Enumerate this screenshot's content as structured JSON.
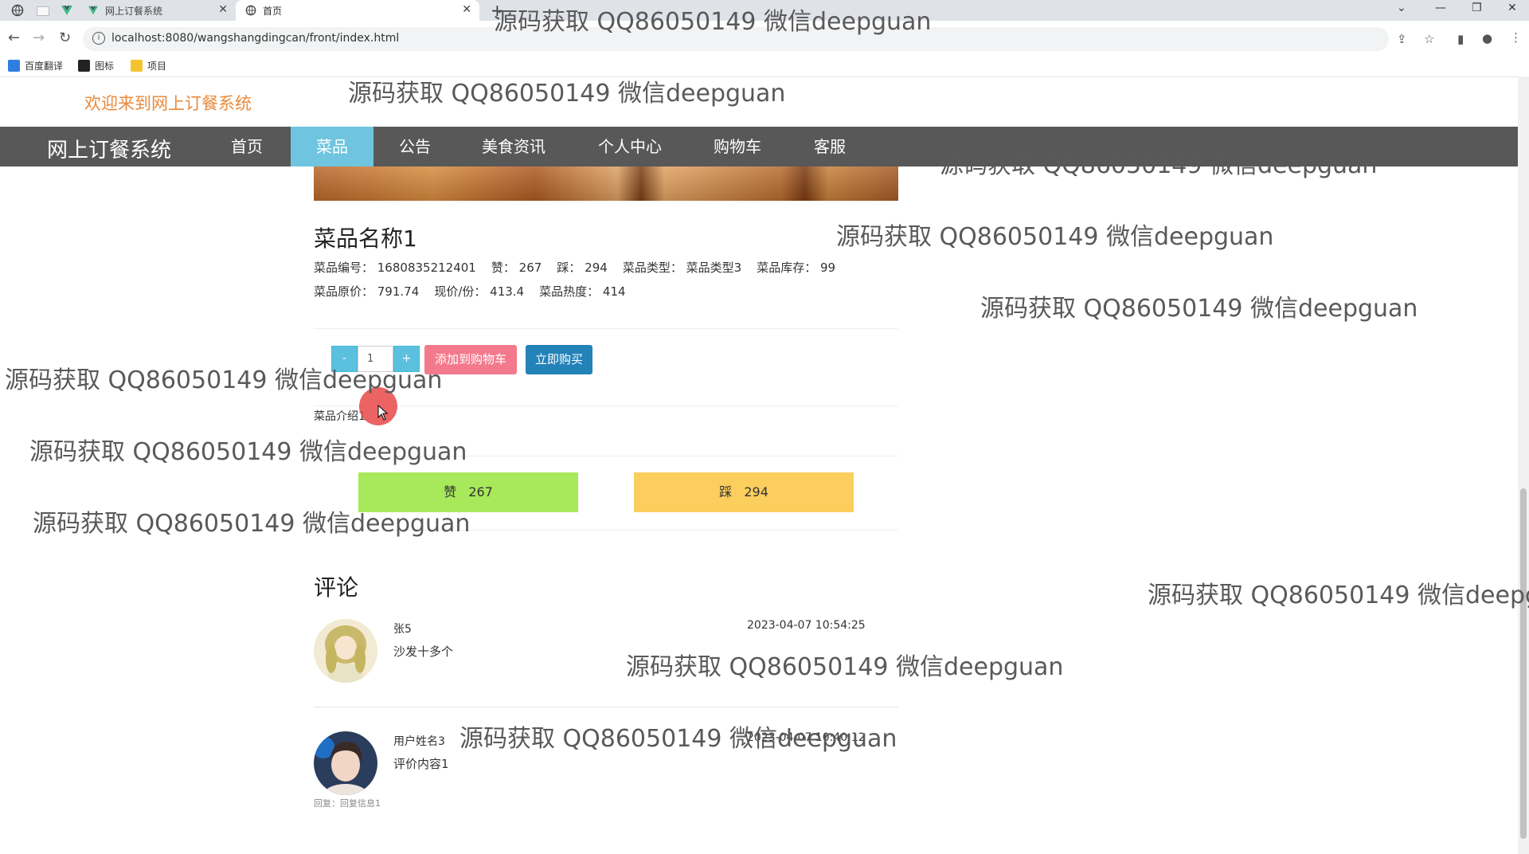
{
  "browser": {
    "tabs": [
      {
        "title": "网上订餐系统",
        "active": false
      },
      {
        "title": "首页",
        "active": true
      }
    ],
    "url": "localhost:8080/wangshangdingcan/front/index.html",
    "bookmarks": [
      "百度翻译",
      "图标",
      "项目"
    ]
  },
  "page": {
    "welcome": "欢迎来到网上订餐系统",
    "brand": "网上订餐系统",
    "nav": [
      "首页",
      "菜品",
      "公告",
      "美食资讯",
      "个人中心",
      "购物车",
      "客服"
    ],
    "active_nav": "菜品"
  },
  "dish": {
    "name": "菜品名称1",
    "line1": "菜品编号： 1680835212401    赞： 267    踩： 294    菜品类型： 菜品类型3    菜品库存： 99",
    "line2": "菜品原价： 791.74    现价/份： 413.4    菜品热度： 414",
    "quantity": "1",
    "minus": "-",
    "plus": "+",
    "add_to_cart": "添加到购物车",
    "buy_now": "立即购买",
    "intro": "菜品介绍1",
    "like_label": "赞",
    "like_count": "267",
    "dislike_label": "踩",
    "dislike_count": "294"
  },
  "comments": {
    "title": "评论",
    "items": [
      {
        "user": "张5",
        "time": "2023-04-07 10:54:25",
        "text": "沙发十多个",
        "reply": ""
      },
      {
        "user": "用户姓名3",
        "time": "2023-04-07 10:40:12",
        "text": "评价内容1",
        "reply": "回复：回复信息1"
      }
    ]
  },
  "watermark": "源码获取 QQ86050149 微信deepguan",
  "colors": {
    "navbar": "#585858",
    "nav_active": "#6fc4e0",
    "welcome": "#e98a3c",
    "add_to_cart": "#f27a8c",
    "buy_now": "#2382b8",
    "like": "#a8e85b",
    "dislike": "#fbce5d"
  }
}
